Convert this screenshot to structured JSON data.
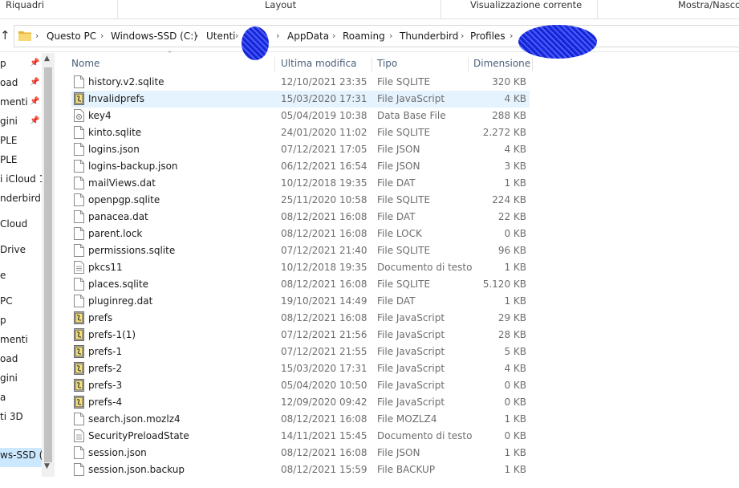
{
  "ribbon": {
    "groups": [
      "Riquadri",
      "Layout",
      "Visualizzazione corrente",
      "Mostra/Nascondi"
    ]
  },
  "address": {
    "crumbs": [
      "Questo PC",
      "Windows-SSD (C:)",
      "Utenti",
      "AppData",
      "Roaming",
      "Thunderbird",
      "Profiles"
    ]
  },
  "nav": {
    "items": [
      "p",
      "oad",
      "menti",
      "gini",
      "PLE",
      "PLE",
      "i iCloud 1",
      "nderbird",
      "Cloud",
      "Drive",
      "e",
      "PC",
      "p",
      "menti",
      "oad",
      "gini",
      "a",
      "ti 3D",
      "ws-SSD (C"
    ]
  },
  "columns": {
    "name": "Nome",
    "modified": "Ultima modifica",
    "type": "Tipo",
    "size": "Dimensione"
  },
  "files": [
    {
      "name": "history.v2.sqlite",
      "modified": "12/10/2021 23:35",
      "type": "File SQLITE",
      "size": "320 KB",
      "icon": "file-icon"
    },
    {
      "name": "Invalidprefs",
      "modified": "15/03/2020 17:31",
      "type": "File JavaScript",
      "size": "4 KB",
      "icon": "js-icon"
    },
    {
      "name": "key4",
      "modified": "05/04/2019 10:38",
      "type": "Data Base File",
      "size": "288 KB",
      "icon": "db-icon"
    },
    {
      "name": "kinto.sqlite",
      "modified": "24/01/2020 11:02",
      "type": "File SQLITE",
      "size": "2.272 KB",
      "icon": "file-icon"
    },
    {
      "name": "logins.json",
      "modified": "07/12/2021 17:05",
      "type": "File JSON",
      "size": "4 KB",
      "icon": "file-icon"
    },
    {
      "name": "logins-backup.json",
      "modified": "06/12/2021 16:54",
      "type": "File JSON",
      "size": "3 KB",
      "icon": "file-icon"
    },
    {
      "name": "mailViews.dat",
      "modified": "10/12/2018 19:35",
      "type": "File DAT",
      "size": "1 KB",
      "icon": "file-icon"
    },
    {
      "name": "openpgp.sqlite",
      "modified": "25/11/2020 10:58",
      "type": "File SQLITE",
      "size": "224 KB",
      "icon": "file-icon"
    },
    {
      "name": "panacea.dat",
      "modified": "08/12/2021 16:08",
      "type": "File DAT",
      "size": "22 KB",
      "icon": "file-icon"
    },
    {
      "name": "parent.lock",
      "modified": "08/12/2021 16:08",
      "type": "File LOCK",
      "size": "0 KB",
      "icon": "file-icon"
    },
    {
      "name": "permissions.sqlite",
      "modified": "07/12/2021 21:40",
      "type": "File SQLITE",
      "size": "96 KB",
      "icon": "file-icon"
    },
    {
      "name": "pkcs11",
      "modified": "10/12/2018 19:35",
      "type": "Documento di testo",
      "size": "1 KB",
      "icon": "text-icon"
    },
    {
      "name": "places.sqlite",
      "modified": "08/12/2021 16:08",
      "type": "File SQLITE",
      "size": "5.120 KB",
      "icon": "file-icon"
    },
    {
      "name": "pluginreg.dat",
      "modified": "19/10/2021 14:49",
      "type": "File DAT",
      "size": "1 KB",
      "icon": "file-icon"
    },
    {
      "name": "prefs",
      "modified": "08/12/2021 16:08",
      "type": "File JavaScript",
      "size": "29 KB",
      "icon": "js-icon"
    },
    {
      "name": "prefs-1(1)",
      "modified": "07/12/2021 21:56",
      "type": "File JavaScript",
      "size": "28 KB",
      "icon": "js-icon"
    },
    {
      "name": "prefs-1",
      "modified": "07/12/2021 21:55",
      "type": "File JavaScript",
      "size": "5 KB",
      "icon": "js-icon"
    },
    {
      "name": "prefs-2",
      "modified": "15/03/2020 17:31",
      "type": "File JavaScript",
      "size": "4 KB",
      "icon": "js-icon"
    },
    {
      "name": "prefs-3",
      "modified": "05/04/2020 10:50",
      "type": "File JavaScript",
      "size": "0 KB",
      "icon": "js-icon"
    },
    {
      "name": "prefs-4",
      "modified": "12/09/2020 09:42",
      "type": "File JavaScript",
      "size": "0 KB",
      "icon": "js-icon"
    },
    {
      "name": "search.json.mozlz4",
      "modified": "08/12/2021 16:08",
      "type": "File MOZLZ4",
      "size": "1 KB",
      "icon": "file-icon"
    },
    {
      "name": "SecurityPreloadState",
      "modified": "14/11/2021 15:45",
      "type": "Documento di testo",
      "size": "0 KB",
      "icon": "text-icon"
    },
    {
      "name": "session.json",
      "modified": "08/12/2021 16:08",
      "type": "File JSON",
      "size": "1 KB",
      "icon": "file-icon"
    },
    {
      "name": "session.json.backup",
      "modified": "08/12/2021 15:59",
      "type": "File BACKUP",
      "size": "1 KB",
      "icon": "file-icon"
    }
  ],
  "highlighted_row": 1,
  "colors": {
    "header_text": "#4c607a",
    "hover_row": "#e5f3ff",
    "selected_nav": "#cce8ff",
    "redaction": "#1a2de0"
  }
}
